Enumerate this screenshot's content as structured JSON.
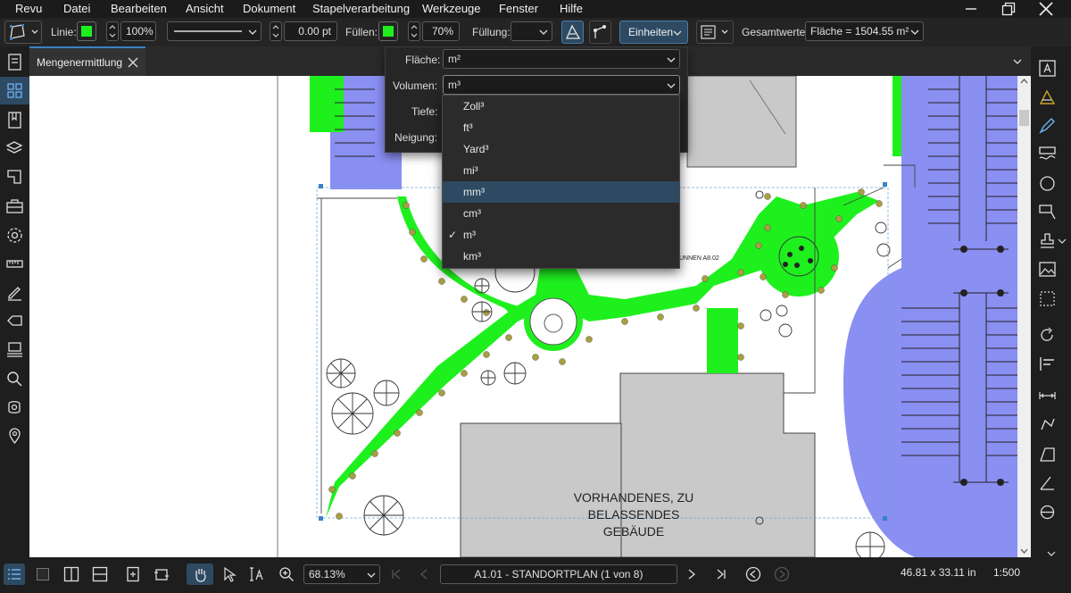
{
  "menu": [
    "Revu",
    "Datei",
    "Bearbeiten",
    "Ansicht",
    "Dokument",
    "Stapelverarbeitung",
    "Werkzeuge",
    "Fenster",
    "Hilfe"
  ],
  "toolbar": {
    "line_label": "Linie:",
    "line_opacity": "100%",
    "line_width": "0.00 pt",
    "fill_label": "Füllen:",
    "fill_opacity": "70%",
    "hatch_label": "Füllung:",
    "units_button": "Einheiten",
    "totals_label": "Gesamtwerte:",
    "totals_value": "Fläche = 1504.55 m²",
    "line_color": "#1ef01e",
    "fill_color": "#1ef01e"
  },
  "tab": {
    "title": "Mengenermittlung"
  },
  "units_panel": {
    "area_label": "Fläche:",
    "area_value": "m²",
    "volume_label": "Volumen:",
    "volume_value": "m³",
    "depth_label": "Tiefe:",
    "slope_label": "Neigung:"
  },
  "volume_options": [
    {
      "label": "Zoll³",
      "checked": false,
      "highlighted": false
    },
    {
      "label": "ft³",
      "checked": false,
      "highlighted": false
    },
    {
      "label": "Yard³",
      "checked": false,
      "highlighted": false
    },
    {
      "label": "mi³",
      "checked": false,
      "highlighted": false
    },
    {
      "label": "mm³",
      "checked": false,
      "highlighted": true
    },
    {
      "label": "cm³",
      "checked": false,
      "highlighted": false
    },
    {
      "label": "m³",
      "checked": true,
      "highlighted": false
    },
    {
      "label": "km³",
      "checked": false,
      "highlighted": false
    }
  ],
  "drawing": {
    "building_label_line1": "VORHANDENES, ZU BELASSENDES",
    "building_label_line2": "GEBÄUDE",
    "partial_label": "UNNEN A8.02"
  },
  "status": {
    "zoom": "68.13%",
    "page": "A1.01 - STANDORTPLAN (1 von 8)",
    "size": "46.81 x 33.11 in",
    "scale": "1:500"
  }
}
